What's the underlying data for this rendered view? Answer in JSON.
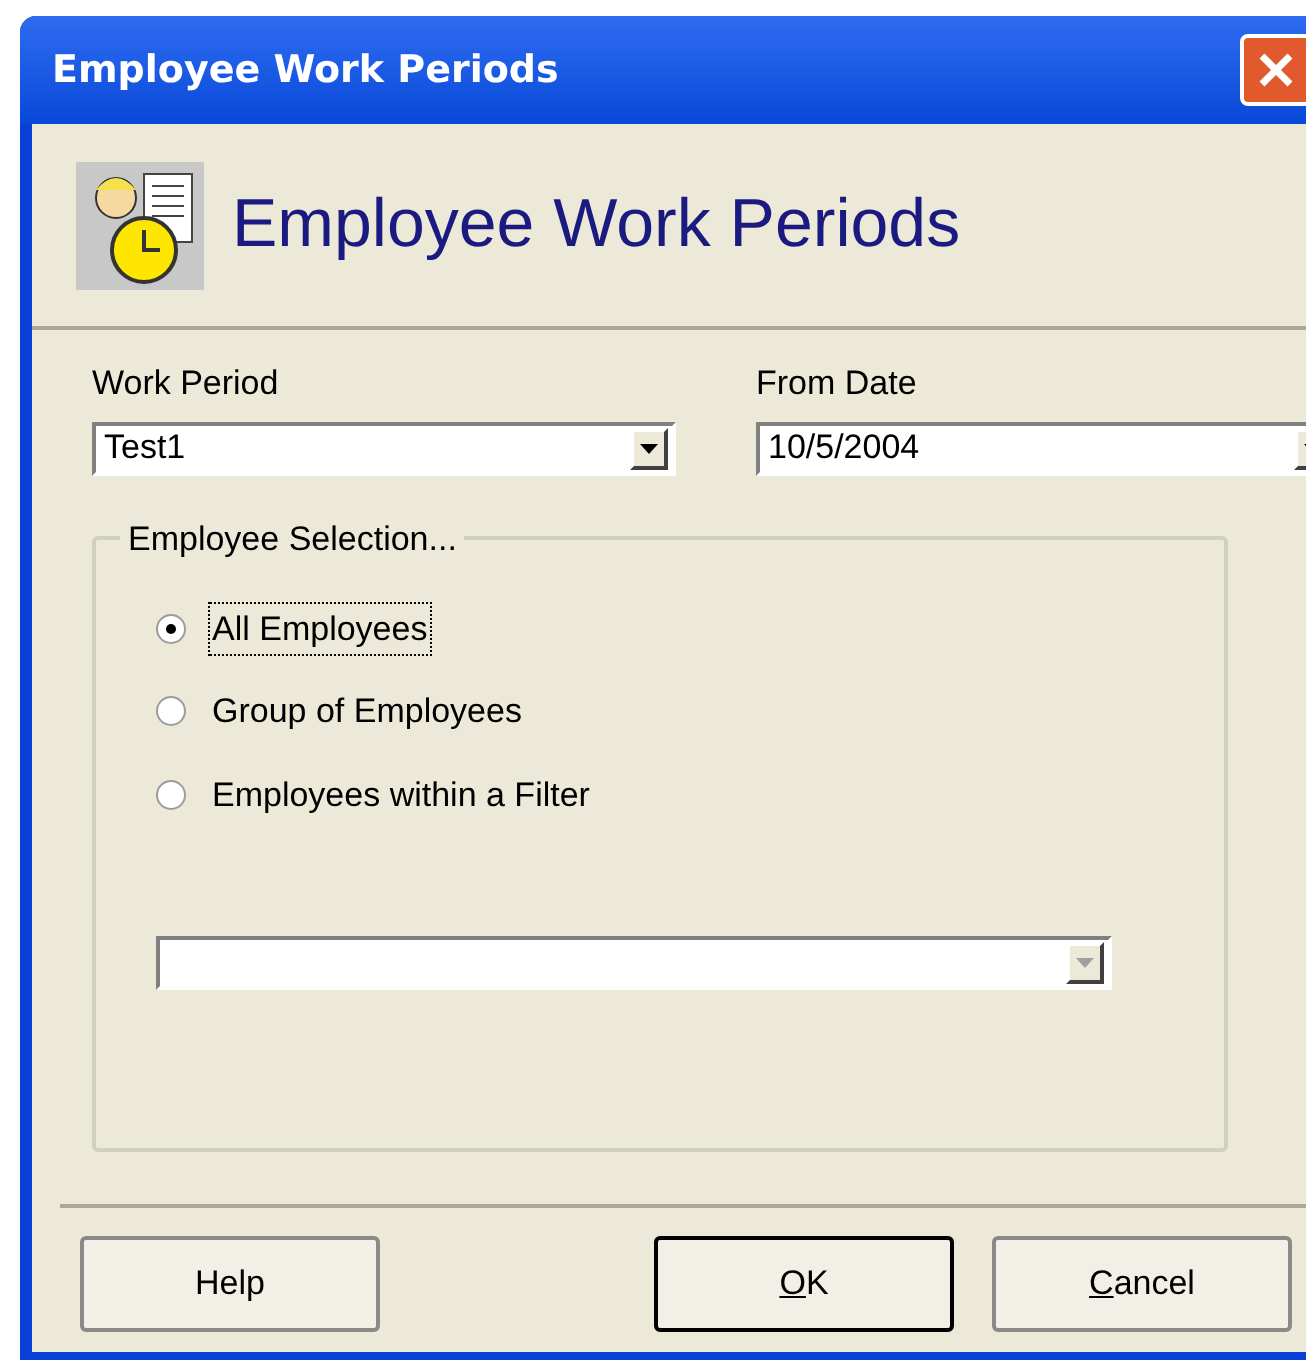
{
  "window": {
    "title": "Employee Work Periods"
  },
  "header": {
    "title": "Employee Work Periods"
  },
  "fields": [
    {
      "label": "Work Period",
      "value": "Test1"
    },
    {
      "label": "From Date",
      "value": "10/5/2004"
    }
  ],
  "employee_selection": {
    "title": "Employee Selection...",
    "options": [
      {
        "label": "All Employees",
        "selected": true,
        "focused": true
      },
      {
        "label": "Group of Employees",
        "selected": false,
        "focused": false
      },
      {
        "label": "Employees within a Filter",
        "selected": false,
        "focused": false
      }
    ],
    "filter_combo": {
      "disabled": true
    }
  },
  "buttons": [
    {
      "label": "Help",
      "default": false,
      "underline_first": false
    },
    {
      "label": "OK",
      "default": true,
      "underline_first": true
    },
    {
      "label": "Cancel",
      "default": false,
      "underline_first": true
    }
  ]
}
